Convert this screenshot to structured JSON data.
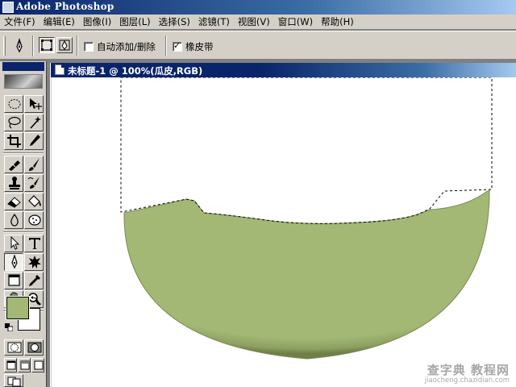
{
  "window": {
    "title": "Adobe Photoshop"
  },
  "menu": [
    {
      "label": "文件(F)"
    },
    {
      "label": "编辑(E)"
    },
    {
      "label": "图像(I)"
    },
    {
      "label": "图层(L)"
    },
    {
      "label": "选择(S)"
    },
    {
      "label": "滤镜(T)"
    },
    {
      "label": "视图(V)"
    },
    {
      "label": "窗口(W)"
    },
    {
      "label": "帮助(H)"
    }
  ],
  "options": {
    "auto_add_delete": {
      "label": "自动添加/删除",
      "checked": false
    },
    "rubber_band": {
      "label": "橡皮带",
      "checked": true
    }
  },
  "colors": {
    "foreground": "#a2b874",
    "background": "#ffffff",
    "shape_fill": "#a2b874"
  },
  "document": {
    "title": "未标题-1 @ 100%(瓜皮,RGB)"
  },
  "watermark": {
    "line1": "查字典 教程网",
    "line2": "jiaocheng.chazidian.com"
  }
}
